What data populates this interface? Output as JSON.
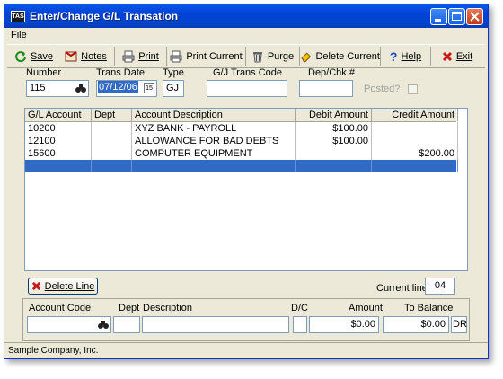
{
  "window": {
    "title": "Enter/Change G/L  Transation",
    "icon_text": "TAS"
  },
  "menu": {
    "file": "File"
  },
  "toolbar": {
    "save": "Save",
    "notes": "Notes",
    "print": "Print",
    "print_current": "Print Current",
    "purge": "Purge",
    "delete_current": "Delete Current",
    "help": "Help",
    "exit": "Exit"
  },
  "header": {
    "number_label": "Number",
    "number_value": "115",
    "trans_date_label": "Trans Date",
    "trans_date_value": "07/12/06",
    "type_label": "Type",
    "type_value": "GJ",
    "gj_trans_code_label": "G/J Trans Code",
    "gj_trans_code_value": "",
    "dep_chk_label": "Dep/Chk #",
    "dep_chk_value": "",
    "posted_label": "Posted?"
  },
  "grid": {
    "columns": [
      "G/L Account",
      "Dept",
      "Account Description",
      "Debit Amount",
      "Credit Amount"
    ],
    "rows": [
      [
        "10200",
        "",
        "XYZ BANK - PAYROLL",
        "$100.00",
        ""
      ],
      [
        "12100",
        "",
        "ALLOWANCE FOR BAD DEBTS",
        "$100.00",
        ""
      ],
      [
        "15600",
        "",
        "COMPUTER EQUIPMENT",
        "",
        "$200.00"
      ]
    ]
  },
  "footer": {
    "delete_line": "Delete Line",
    "current_line_label": "Current line",
    "current_line_value": "04"
  },
  "entry": {
    "account_code_label": "Account Code",
    "dept_label": "Dept",
    "description_label": "Description",
    "dc_label": "D/C",
    "amount_label": "Amount",
    "to_balance_label": "To Balance",
    "amount_value": "$0.00",
    "to_balance_value": "$0.00",
    "dr_value": "DR"
  },
  "status": {
    "company": "Sample Company, Inc."
  },
  "colors": {
    "title_bar": "#0342d6",
    "selection": "#316ac5",
    "window_bg": "#ece9d8"
  }
}
